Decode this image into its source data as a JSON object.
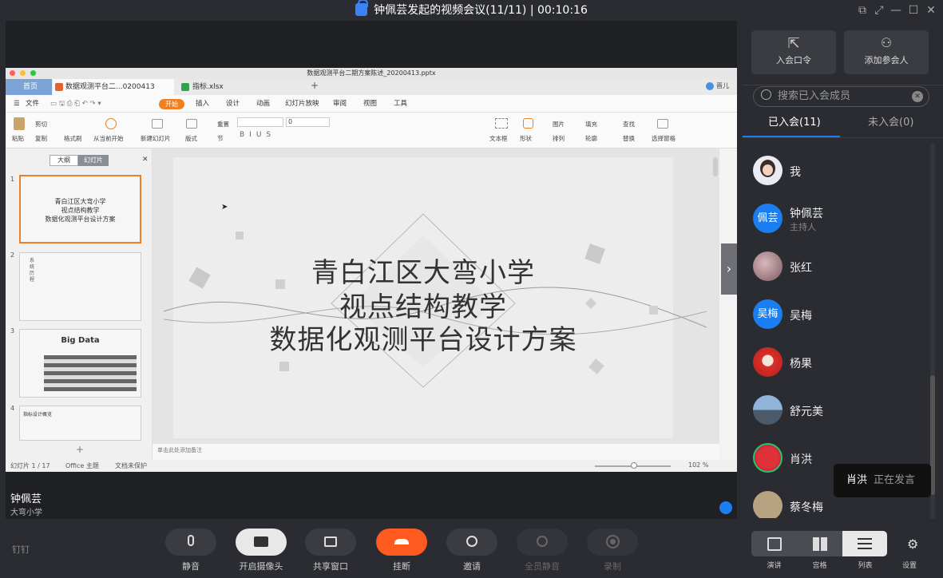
{
  "window": {
    "title": "钟佩芸发起的视频会议(11/11) | 00:10:16"
  },
  "ppt": {
    "doc_title": "数据观测平台二期方案陈述_20200413.pptx",
    "tabs": [
      "首页",
      "数据观测平台二...0200413",
      "指标.xlsx"
    ],
    "user": "晋儿",
    "menu": [
      "文件",
      "开始",
      "插入",
      "设计",
      "动画",
      "幻灯片放映",
      "审阅",
      "视图",
      "工具"
    ],
    "ribbon": [
      "粘贴",
      "剪切",
      "复制",
      "格式刷",
      "从当前开始",
      "新建幻灯片",
      "版式",
      "重置",
      "节",
      "文本框",
      "形状",
      "图片",
      "排列",
      "填充",
      "轮廓",
      "查找",
      "替换",
      "选择窗格"
    ],
    "font_size": "0",
    "pane_tabs": [
      "大纲",
      "幻灯片"
    ],
    "slide_numbers": [
      "1",
      "2",
      "3",
      "4"
    ],
    "thumb1": [
      "青白江区大弯小学",
      "视点结构教学",
      "数据化观测平台设计方案"
    ],
    "thumb2_label": "系统历程",
    "thumb3_title": "Big    Data",
    "thumb4_title": "指标设计概览",
    "slide": [
      "青白江区大弯小学",
      "视点结构教学",
      "数据化观测平台设计方案"
    ],
    "notes": "单击此处添加备注",
    "status": {
      "slide_count": "幻灯片 1 / 17",
      "theme": "Office 主题",
      "protect": "文档未保护",
      "zoom": "102 %"
    }
  },
  "speaker": {
    "name": "钟佩芸",
    "org": "大弯小学"
  },
  "sidebar": {
    "join_code": "入会口令",
    "add_participant": "添加参会人",
    "search_placeholder": "搜索已入会成员",
    "tab_joined": "已入会(11)",
    "tab_not_joined": "未入会(0)",
    "members": [
      {
        "name": "我",
        "sub": ""
      },
      {
        "name": "钟佩芸",
        "sub": "主持人",
        "avatar_text": "佩芸"
      },
      {
        "name": "张红",
        "sub": ""
      },
      {
        "name": "吴梅",
        "sub": "",
        "avatar_text": "吴梅"
      },
      {
        "name": "杨果",
        "sub": ""
      },
      {
        "name": "舒元美",
        "sub": ""
      },
      {
        "name": "肖洪",
        "sub": ""
      },
      {
        "name": "蔡冬梅",
        "sub": ""
      }
    ],
    "speaking_popup": {
      "name": "肖洪",
      "status": "正在发言"
    }
  },
  "controls": {
    "brand": "钉钉",
    "buttons": [
      "静音",
      "开启摄像头",
      "共享窗口",
      "挂断",
      "邀请",
      "全员静音",
      "录制"
    ],
    "views": [
      "演讲",
      "宫格",
      "列表"
    ],
    "settings": "设置"
  },
  "colors": {
    "accent": "#1a7df0",
    "hangup": "#ff5a1f",
    "ppt_orange": "#f07f21"
  }
}
